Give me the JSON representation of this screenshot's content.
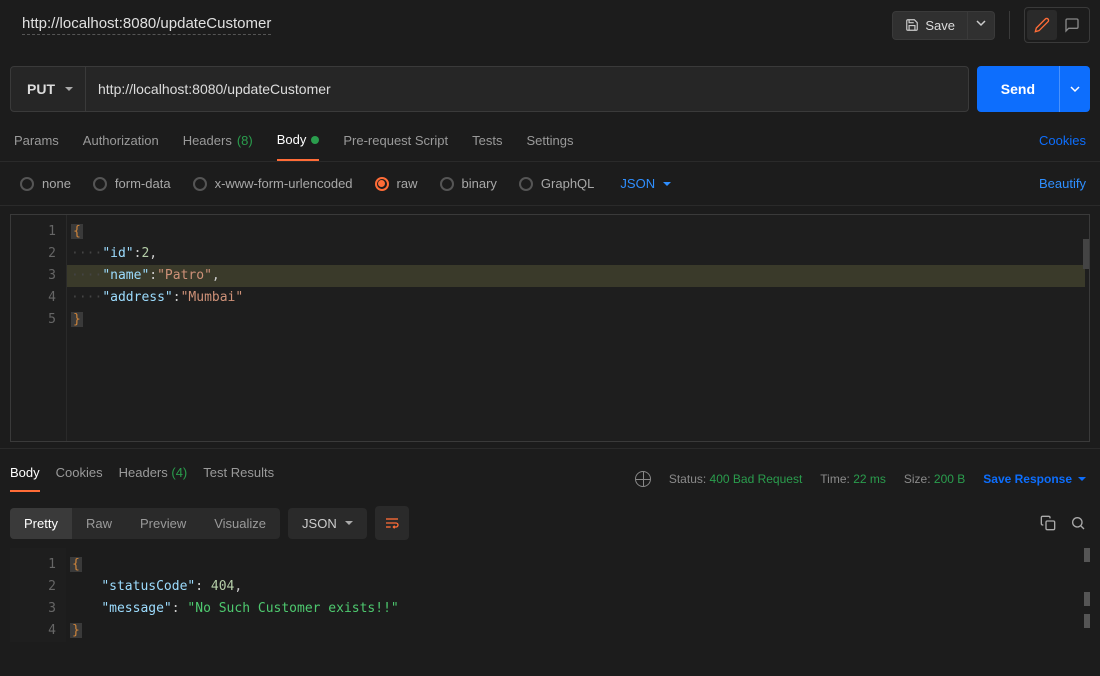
{
  "header": {
    "title": "http://localhost:8080/updateCustomer",
    "save_label": "Save"
  },
  "request": {
    "method": "PUT",
    "url": "http://localhost:8080/updateCustomer",
    "send_label": "Send"
  },
  "tabs": {
    "params": "Params",
    "authorization": "Authorization",
    "headers_label": "Headers",
    "headers_count": "(8)",
    "body": "Body",
    "prerequest": "Pre-request Script",
    "tests": "Tests",
    "settings": "Settings",
    "cookies_link": "Cookies"
  },
  "body_types": {
    "none": "none",
    "formdata": "form-data",
    "urlenc": "x-www-form-urlencoded",
    "raw": "raw",
    "binary": "binary",
    "graphql": "GraphQL",
    "format": "JSON",
    "beautify": "Beautify"
  },
  "request_body": {
    "id_key": "\"id\"",
    "id_val": "2",
    "name_key": "\"name\"",
    "name_val": "\"Patro\"",
    "addr_key": "\"address\"",
    "addr_val": "\"Mumbai\""
  },
  "response": {
    "tabs": {
      "body": "Body",
      "cookies": "Cookies",
      "headers_label": "Headers",
      "headers_count": "(4)",
      "test_results": "Test Results"
    },
    "meta": {
      "status_label": "Status:",
      "status_value": "400 Bad Request",
      "time_label": "Time:",
      "time_value": "22 ms",
      "size_label": "Size:",
      "size_value": "200 B",
      "save_response": "Save Response"
    },
    "view": {
      "pretty": "Pretty",
      "raw": "Raw",
      "preview": "Preview",
      "visualize": "Visualize",
      "format": "JSON"
    },
    "body": {
      "status_key": "\"statusCode\"",
      "status_val": "404",
      "msg_key": "\"message\"",
      "msg_val": "\"No Such Customer exists!!\""
    }
  }
}
